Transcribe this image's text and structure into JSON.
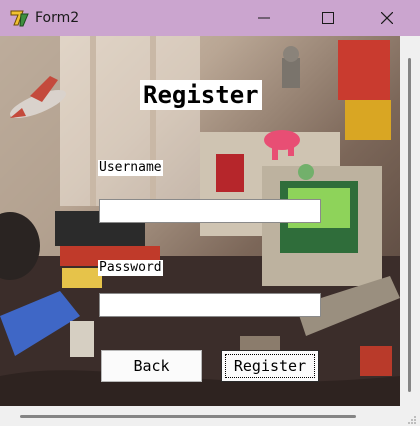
{
  "window": {
    "title": "Form2",
    "controls": {
      "minimize": "minimize-icon",
      "maximize": "maximize-icon",
      "close": "close-icon"
    }
  },
  "form": {
    "heading": "Register",
    "username_label": "Username",
    "username_value": "",
    "password_label": "Password",
    "password_value": "",
    "back_label": "Back",
    "register_label": "Register"
  },
  "colors": {
    "titlebar": "#cba5cf",
    "label_background": "#ffffff",
    "button_background": "#fbfbfb"
  },
  "background_image": "retro-gaming-room-photo"
}
